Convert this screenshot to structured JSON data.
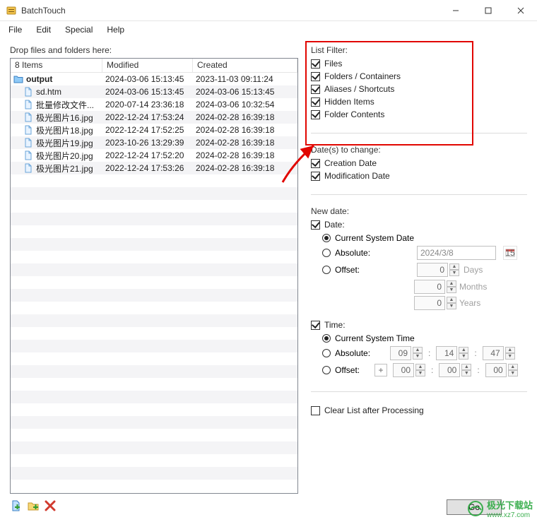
{
  "window": {
    "title": "BatchTouch",
    "controls": {
      "minimize": "—",
      "maximize": "▢",
      "close": "✕"
    }
  },
  "menu": {
    "items": [
      "File",
      "Edit",
      "Special",
      "Help"
    ]
  },
  "left": {
    "drop_label": "Drop files and folders here:",
    "columns": {
      "items_caption": "8 Items",
      "modified": "Modified",
      "created": "Created"
    },
    "rows": [
      {
        "indent": 0,
        "icon": "folder",
        "name": "output",
        "bold": true,
        "modified": "2024-03-06 15:13:45",
        "created": "2023-11-03 09:11:24"
      },
      {
        "indent": 1,
        "icon": "file",
        "name": "sd.htm",
        "bold": false,
        "modified": "2024-03-06 15:13:45",
        "created": "2024-03-06 15:13:45"
      },
      {
        "indent": 1,
        "icon": "file",
        "name": "批量修改文件...",
        "bold": false,
        "modified": "2020-07-14 23:36:18",
        "created": "2024-03-06 10:32:54"
      },
      {
        "indent": 1,
        "icon": "file",
        "name": "极光图片16.jpg",
        "bold": false,
        "modified": "2022-12-24 17:53:24",
        "created": "2024-02-28 16:39:18"
      },
      {
        "indent": 1,
        "icon": "file",
        "name": "极光图片18.jpg",
        "bold": false,
        "modified": "2022-12-24 17:52:25",
        "created": "2024-02-28 16:39:18"
      },
      {
        "indent": 1,
        "icon": "file",
        "name": "极光图片19.jpg",
        "bold": false,
        "modified": "2023-10-26 13:29:39",
        "created": "2024-02-28 16:39:18"
      },
      {
        "indent": 1,
        "icon": "file",
        "name": "极光图片20.jpg",
        "bold": false,
        "modified": "2022-12-24 17:52:20",
        "created": "2024-02-28 16:39:18"
      },
      {
        "indent": 1,
        "icon": "file",
        "name": "极光图片21.jpg",
        "bold": false,
        "modified": "2022-12-24 17:53:26",
        "created": "2024-02-28 16:39:18"
      }
    ]
  },
  "listfilter": {
    "title": "List Filter:",
    "items": [
      {
        "label": "Files",
        "checked": true
      },
      {
        "label": "Folders / Containers",
        "checked": true
      },
      {
        "label": "Aliases / Shortcuts",
        "checked": true
      },
      {
        "label": "Hidden Items",
        "checked": true
      },
      {
        "label": "Folder Contents",
        "checked": true
      }
    ]
  },
  "dates_change": {
    "title": "Date(s) to change:",
    "items": [
      {
        "label": "Creation Date",
        "checked": true
      },
      {
        "label": "Modification Date",
        "checked": true
      }
    ]
  },
  "newdate": {
    "title": "New date:",
    "date_checkbox": "Date:",
    "date_radios": {
      "current": "Current System Date",
      "absolute": "Absolute:",
      "absolute_value": "2024/3/8",
      "offset": "Offset:",
      "offset_value": "0",
      "offset_units": {
        "days": "Days",
        "months": "Months",
        "years": "Years"
      },
      "offset_months_value": "0",
      "offset_years_value": "0"
    },
    "time_checkbox": "Time:",
    "time_radios": {
      "current": "Current System Time",
      "absolute": "Absolute:",
      "abs_h": "09",
      "abs_m": "14",
      "abs_s": "47",
      "offset": "Offset:",
      "off_h": "00",
      "off_m": "00",
      "off_s": "00"
    }
  },
  "clear_list": {
    "label": "Clear List after Processing",
    "checked": false
  },
  "go_button": "Go",
  "watermark": {
    "cn": "极光下载站",
    "url": "www.xz7.com"
  }
}
